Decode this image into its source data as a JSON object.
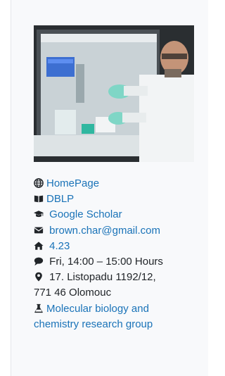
{
  "profile": {
    "photo_alt": "",
    "homepage_label": "HomePage",
    "dblp_label": "DBLP",
    "scholar_label": "Google Scholar",
    "email": "brown.char@gmail.com",
    "office": "4.23",
    "hours": "Fri, 14:00 – 15:00 Hours",
    "address_line1": "17. Listopadu 1192/12,",
    "address_line2": "771 46 Olomouc",
    "group_line1": "Molecular biology and",
    "group_line2": "chemistry research group"
  },
  "colors": {
    "link": "#1a73b8",
    "text": "#212529",
    "card_bg": "#f8f9fb"
  },
  "icons": {
    "homepage": "globe-icon",
    "dblp": "book-icon",
    "scholar": "graduation-cap-icon",
    "email": "envelope-icon",
    "office": "home-icon",
    "hours": "chat-bubble-icon",
    "address": "map-marker-icon",
    "group": "flask-icon"
  }
}
